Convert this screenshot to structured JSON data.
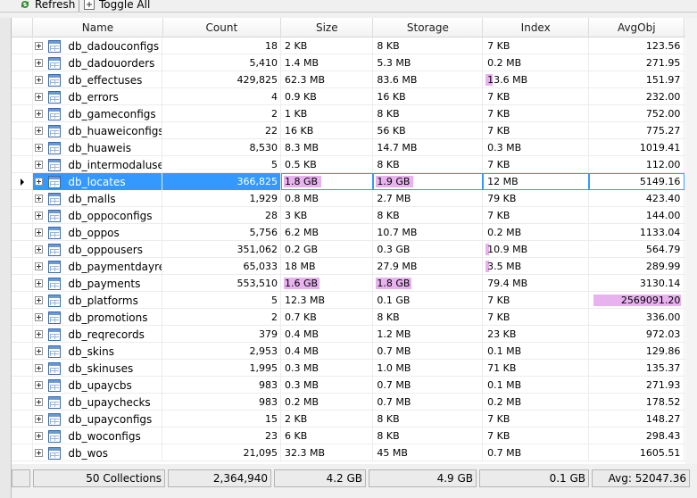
{
  "toolbar": {
    "refresh_label": "Refresh",
    "toggle_label": "Toggle All"
  },
  "columns": {
    "name": "Name",
    "count": "Count",
    "size": "Size",
    "storage": "Storage",
    "index": "Index",
    "avgobj": "AvgObj"
  },
  "rows": [
    {
      "name": "db_dadouconfigs",
      "count": "18",
      "size": "2 KB",
      "storage": "8 KB",
      "index": "7 KB",
      "avgobj": "123.56"
    },
    {
      "name": "db_dadouorders",
      "count": "5,410",
      "size": "1.4 MB",
      "storage": "5.3 MB",
      "index": "0.2 MB",
      "avgobj": "271.95"
    },
    {
      "name": "db_effectuses",
      "count": "429,825",
      "size": "62.3 MB",
      "storage": "83.6 MB",
      "index": "13.6 MB",
      "avgobj": "151.97"
    },
    {
      "name": "db_errors",
      "count": "4",
      "size": "0.9 KB",
      "storage": "16 KB",
      "index": "7 KB",
      "avgobj": "232.00"
    },
    {
      "name": "db_gameconfigs",
      "count": "2",
      "size": "1 KB",
      "storage": "8 KB",
      "index": "7 KB",
      "avgobj": "752.00"
    },
    {
      "name": "db_huaweiconfigs",
      "count": "22",
      "size": "16 KB",
      "storage": "56 KB",
      "index": "7 KB",
      "avgobj": "775.27"
    },
    {
      "name": "db_huaweis",
      "count": "8,530",
      "size": "8.3 MB",
      "storage": "14.7 MB",
      "index": "0.3 MB",
      "avgobj": "1019.41"
    },
    {
      "name": "db_intermodalusers",
      "count": "5",
      "size": "0.5 KB",
      "storage": "8 KB",
      "index": "7 KB",
      "avgobj": "112.00"
    },
    {
      "name": "db_locates",
      "count": "366,825",
      "size": "1.8 GB",
      "storage": "1.9 GB",
      "index": "12 MB",
      "avgobj": "5149.16"
    },
    {
      "name": "db_malls",
      "count": "1,929",
      "size": "0.8 MB",
      "storage": "2.7 MB",
      "index": "79 KB",
      "avgobj": "423.40"
    },
    {
      "name": "db_oppoconfigs",
      "count": "28",
      "size": "3 KB",
      "storage": "8 KB",
      "index": "7 KB",
      "avgobj": "144.00"
    },
    {
      "name": "db_oppos",
      "count": "5,756",
      "size": "6.2 MB",
      "storage": "10.7 MB",
      "index": "0.2 MB",
      "avgobj": "1133.04"
    },
    {
      "name": "db_oppousers",
      "count": "351,062",
      "size": "0.2 GB",
      "storage": "0.3 GB",
      "index": "10.9 MB",
      "avgobj": "564.79"
    },
    {
      "name": "db_paymentdayrep...",
      "count": "65,033",
      "size": "18 MB",
      "storage": "27.9 MB",
      "index": "3.5 MB",
      "avgobj": "289.99"
    },
    {
      "name": "db_payments",
      "count": "553,510",
      "size": "1.6 GB",
      "storage": "1.8 GB",
      "index": "79.4 MB",
      "avgobj": "3130.14"
    },
    {
      "name": "db_platforms",
      "count": "5",
      "size": "12.3 MB",
      "storage": "0.1 GB",
      "index": "7 KB",
      "avgobj": "2569091.20"
    },
    {
      "name": "db_promotions",
      "count": "2",
      "size": "0.7 KB",
      "storage": "8 KB",
      "index": "7 KB",
      "avgobj": "336.00"
    },
    {
      "name": "db_reqrecords",
      "count": "379",
      "size": "0.4 MB",
      "storage": "1.2 MB",
      "index": "23 KB",
      "avgobj": "972.03"
    },
    {
      "name": "db_skins",
      "count": "2,953",
      "size": "0.4 MB",
      "storage": "0.7 MB",
      "index": "0.1 MB",
      "avgobj": "129.86"
    },
    {
      "name": "db_skinuses",
      "count": "1,995",
      "size": "0.3 MB",
      "storage": "1.0 MB",
      "index": "71 KB",
      "avgobj": "135.37"
    },
    {
      "name": "db_upaycbs",
      "count": "983",
      "size": "0.3 MB",
      "storage": "0.7 MB",
      "index": "0.1 MB",
      "avgobj": "271.93"
    },
    {
      "name": "db_upaychecks",
      "count": "983",
      "size": "0.2 MB",
      "storage": "0.7 MB",
      "index": "0.2 MB",
      "avgobj": "178.52"
    },
    {
      "name": "db_upayconfigs",
      "count": "15",
      "size": "2 KB",
      "storage": "8 KB",
      "index": "7 KB",
      "avgobj": "148.27"
    },
    {
      "name": "db_woconfigs",
      "count": "23",
      "size": "6 KB",
      "storage": "8 KB",
      "index": "7 KB",
      "avgobj": "298.43"
    },
    {
      "name": "db_wos",
      "count": "21,095",
      "size": "32.3 MB",
      "storage": "45 MB",
      "index": "0.7 MB",
      "avgobj": "1605.51"
    }
  ],
  "selected_row": "db_locates",
  "highlight_color": "#e8b2ee",
  "selection_color": "#3399ff",
  "footer": {
    "collections": "50 Collections",
    "count": "2,364,940",
    "size": "4.2 GB",
    "storage": "4.9 GB",
    "index": "0.1 GB",
    "avgobj": "Avg: 52047.36"
  }
}
